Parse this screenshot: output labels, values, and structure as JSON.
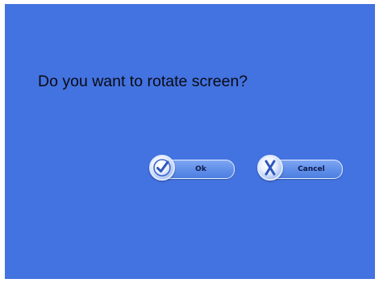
{
  "dialog": {
    "question": "Do you want to rotate screen?",
    "ok_label": "Ok",
    "cancel_label": "Cancel"
  },
  "colors": {
    "background": "#4373e0",
    "text": "#0a0a14",
    "button_fill": "#5f8ee9",
    "button_border": "#e6eeff"
  },
  "icons": {
    "ok": "checkmark-icon",
    "cancel": "x-mark-icon"
  }
}
